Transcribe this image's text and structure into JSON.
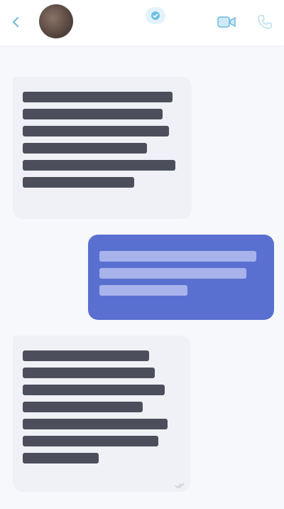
{
  "header": {
    "contact_name": "",
    "contact_status": ""
  },
  "icons": {
    "back": "arrow-left-icon",
    "verified": "verified-badge-icon",
    "video": "video-camera-icon",
    "call": "phone-icon",
    "read": "double-check-icon"
  },
  "colors": {
    "incoming_bubble": "#f0f1f7",
    "outgoing_bubble": "#5a70d0",
    "accent": "#5aa7dc",
    "background": "#f7f8fc"
  },
  "messages": [
    {
      "sender": "contact",
      "text": ""
    },
    {
      "sender": "me",
      "text": ""
    },
    {
      "sender": "contact",
      "text": ""
    }
  ],
  "timestamp": ""
}
